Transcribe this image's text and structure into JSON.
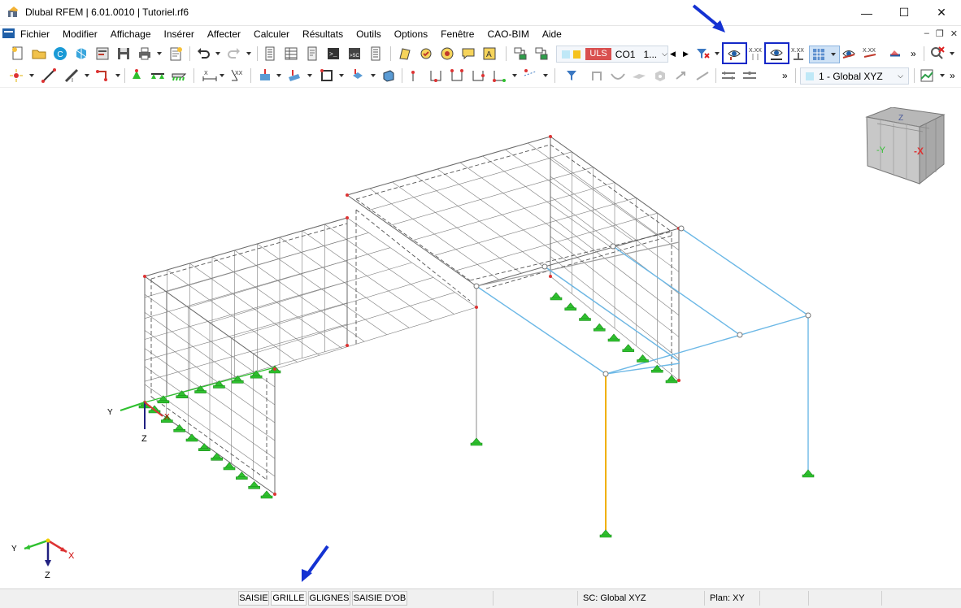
{
  "window": {
    "title": "Dlubal RFEM | 6.01.0010 | Tutoriel.rf6",
    "minimize": "—",
    "maximize": "☐",
    "close": "✕"
  },
  "menu": [
    "Fichier",
    "Modifier",
    "Affichage",
    "Insérer",
    "Affecter",
    "Calculer",
    "Résultats",
    "Outils",
    "Options",
    "Fenêtre",
    "CAO-BIM",
    "Aide"
  ],
  "mdi": {
    "min": "–",
    "restore": "❐",
    "close": "✕"
  },
  "toolbar1": {
    "uls_badge": "ULS",
    "load_case": "CO1",
    "load_combo_value": "1...",
    "more": "»"
  },
  "toolbar2": {
    "coord_system": "1 - Global XYZ",
    "more": "»"
  },
  "view_cube": {
    "face_right": "-X",
    "face_left": "-Y",
    "face_top": "Z"
  },
  "axes": {
    "x": "X",
    "y": "Y",
    "z": "Z"
  },
  "status": {
    "btn_saisie": "SAISIE",
    "btn_grille": "GRILLE",
    "btn_glignes": "GLIGNES",
    "btn_saisie_ob": "SAISIE D'OB",
    "sc": "SC: Global XYZ",
    "plan": "Plan: XY"
  },
  "colors": {
    "accent_blue": "#1428c8",
    "arrow_blue": "#1432d2",
    "member_blue": "#6cb8e6",
    "member_orange": "#f0b000",
    "support_green": "#2ec02e",
    "uls_red": "#d95050"
  }
}
